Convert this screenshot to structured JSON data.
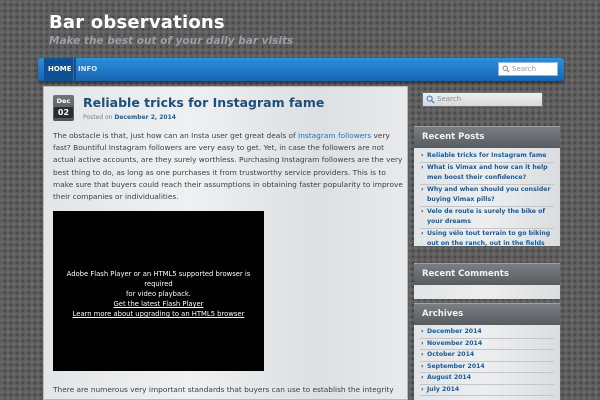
{
  "site": {
    "title": "Bar observations",
    "description": "Make the best out of your daily bar visits"
  },
  "nav": {
    "items": [
      "HOME",
      "INFO"
    ],
    "search_placeholder": "Search"
  },
  "post": {
    "date_month": "Dec",
    "date_day": "02",
    "title": "Reliable tricks for Instagram fame",
    "posted_on_label": "Posted on",
    "posted_on_date": "December 2, 2014",
    "para1_before_link": "The obstacle is that, just how can an Insta user get great deals of ",
    "para1_link": "Instagram followers",
    "para1_after_link": " very fast? Bountiful Instagram followers are very easy to get. Yet, in case the followers are not actual active accounts, are they surely worthless. Purchasing Instagram followers are the very best thing to do, as long as one purchases it from trustworthy service providers. This is to make sure that buyers could reach their assumptions in obtaining faster popularity to improve their companies or individualities.",
    "video": {
      "line1": "Adobe Flash Player or an HTML5 supported browser is required",
      "line2": "for video playback.",
      "link1": "Get the latest Flash Player",
      "link2": "Learn more about upgrading to an HTML5 browser"
    },
    "para2": "There are numerous very important standards that buyers can use to establish the integrity"
  },
  "sidebar": {
    "search_placeholder": "Search",
    "recent_posts_title": "Recent Posts",
    "recent_posts": [
      "Reliable tricks for Instagram fame",
      "What is Vimax and how can it help men boost their confidence?",
      "Why and when should you consider buying Vimax pills?",
      "Velo de route is surely the bike of your dreams",
      "Using vélo tout terrain to go biking out on the ranch, out in the fields"
    ],
    "recent_comments_title": "Recent Comments",
    "archives_title": "Archives",
    "archives": [
      "December 2014",
      "November 2014",
      "October 2014",
      "September 2014",
      "August 2014",
      "July 2014"
    ]
  }
}
